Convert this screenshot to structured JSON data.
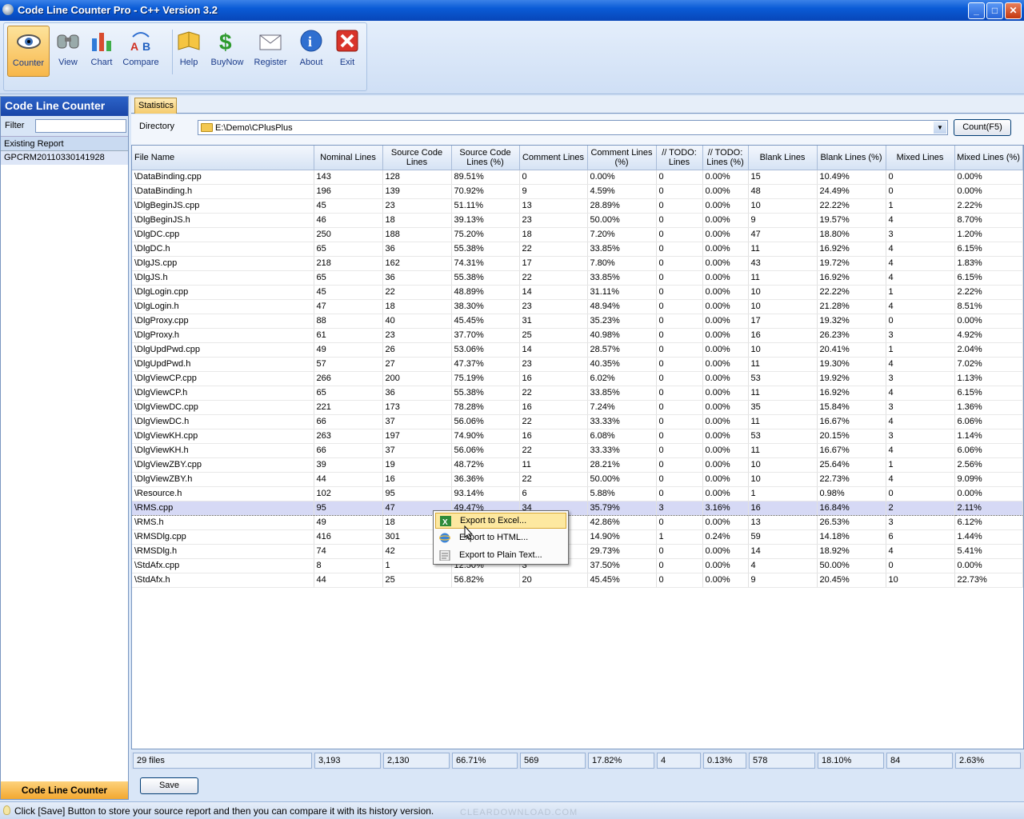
{
  "window": {
    "title": "Code Line Counter Pro - C++ Version 3.2",
    "buttons": {
      "minimize": "_",
      "maximize": "□",
      "close": "✕"
    }
  },
  "toolbar": {
    "items": [
      {
        "label": "Counter",
        "icon": "eye-icon",
        "active": true
      },
      {
        "label": "View",
        "icon": "binoculars-icon"
      },
      {
        "label": "Chart",
        "icon": "chart-icon"
      },
      {
        "label": "Compare",
        "icon": "compare-ab-icon"
      },
      {
        "label": "Help",
        "icon": "book-icon"
      },
      {
        "label": "BuyNow",
        "icon": "dollar-icon"
      },
      {
        "label": "Register",
        "icon": "envelope-icon"
      },
      {
        "label": "About",
        "icon": "info-icon"
      },
      {
        "label": "Exit",
        "icon": "exit-x-icon"
      }
    ]
  },
  "left_panel": {
    "title": "Code Line Counter",
    "filter_label": "Filter",
    "filter_value": "",
    "existing_report_label": "Existing Report",
    "reports": [
      "GPCRM20110330141928"
    ],
    "footer": "Code Line Counter"
  },
  "tab": {
    "label": "Statistics"
  },
  "directory": {
    "label": "Directory",
    "path": "E:\\Demo\\CPlusPlus",
    "count_button": "Count(F5)"
  },
  "table": {
    "columns": [
      "File Name",
      "Nominal Lines",
      "Source Code Lines",
      "Source Code Lines (%)",
      "Comment Lines",
      "Comment Lines (%)",
      "// TODO: Lines",
      "// TODO: Lines (%)",
      "Blank Lines",
      "Blank Lines (%)",
      "Mixed Lines",
      "Mixed Lines (%)"
    ],
    "selected_row": 23,
    "rows": [
      [
        "\\DataBinding.cpp",
        "143",
        "128",
        "89.51%",
        "0",
        "0.00%",
        "0",
        "0.00%",
        "15",
        "10.49%",
        "0",
        "0.00%"
      ],
      [
        "\\DataBinding.h",
        "196",
        "139",
        "70.92%",
        "9",
        "4.59%",
        "0",
        "0.00%",
        "48",
        "24.49%",
        "0",
        "0.00%"
      ],
      [
        "\\DlgBeginJS.cpp",
        "45",
        "23",
        "51.11%",
        "13",
        "28.89%",
        "0",
        "0.00%",
        "10",
        "22.22%",
        "1",
        "2.22%"
      ],
      [
        "\\DlgBeginJS.h",
        "46",
        "18",
        "39.13%",
        "23",
        "50.00%",
        "0",
        "0.00%",
        "9",
        "19.57%",
        "4",
        "8.70%"
      ],
      [
        "\\DlgDC.cpp",
        "250",
        "188",
        "75.20%",
        "18",
        "7.20%",
        "0",
        "0.00%",
        "47",
        "18.80%",
        "3",
        "1.20%"
      ],
      [
        "\\DlgDC.h",
        "65",
        "36",
        "55.38%",
        "22",
        "33.85%",
        "0",
        "0.00%",
        "11",
        "16.92%",
        "4",
        "6.15%"
      ],
      [
        "\\DlgJS.cpp",
        "218",
        "162",
        "74.31%",
        "17",
        "7.80%",
        "0",
        "0.00%",
        "43",
        "19.72%",
        "4",
        "1.83%"
      ],
      [
        "\\DlgJS.h",
        "65",
        "36",
        "55.38%",
        "22",
        "33.85%",
        "0",
        "0.00%",
        "11",
        "16.92%",
        "4",
        "6.15%"
      ],
      [
        "\\DlgLogin.cpp",
        "45",
        "22",
        "48.89%",
        "14",
        "31.11%",
        "0",
        "0.00%",
        "10",
        "22.22%",
        "1",
        "2.22%"
      ],
      [
        "\\DlgLogin.h",
        "47",
        "18",
        "38.30%",
        "23",
        "48.94%",
        "0",
        "0.00%",
        "10",
        "21.28%",
        "4",
        "8.51%"
      ],
      [
        "\\DlgProxy.cpp",
        "88",
        "40",
        "45.45%",
        "31",
        "35.23%",
        "0",
        "0.00%",
        "17",
        "19.32%",
        "0",
        "0.00%"
      ],
      [
        "\\DlgProxy.h",
        "61",
        "23",
        "37.70%",
        "25",
        "40.98%",
        "0",
        "0.00%",
        "16",
        "26.23%",
        "3",
        "4.92%"
      ],
      [
        "\\DlgUpdPwd.cpp",
        "49",
        "26",
        "53.06%",
        "14",
        "28.57%",
        "0",
        "0.00%",
        "10",
        "20.41%",
        "1",
        "2.04%"
      ],
      [
        "\\DlgUpdPwd.h",
        "57",
        "27",
        "47.37%",
        "23",
        "40.35%",
        "0",
        "0.00%",
        "11",
        "19.30%",
        "4",
        "7.02%"
      ],
      [
        "\\DlgViewCP.cpp",
        "266",
        "200",
        "75.19%",
        "16",
        "6.02%",
        "0",
        "0.00%",
        "53",
        "19.92%",
        "3",
        "1.13%"
      ],
      [
        "\\DlgViewCP.h",
        "65",
        "36",
        "55.38%",
        "22",
        "33.85%",
        "0",
        "0.00%",
        "11",
        "16.92%",
        "4",
        "6.15%"
      ],
      [
        "\\DlgViewDC.cpp",
        "221",
        "173",
        "78.28%",
        "16",
        "7.24%",
        "0",
        "0.00%",
        "35",
        "15.84%",
        "3",
        "1.36%"
      ],
      [
        "\\DlgViewDC.h",
        "66",
        "37",
        "56.06%",
        "22",
        "33.33%",
        "0",
        "0.00%",
        "11",
        "16.67%",
        "4",
        "6.06%"
      ],
      [
        "\\DlgViewKH.cpp",
        "263",
        "197",
        "74.90%",
        "16",
        "6.08%",
        "0",
        "0.00%",
        "53",
        "20.15%",
        "3",
        "1.14%"
      ],
      [
        "\\DlgViewKH.h",
        "66",
        "37",
        "56.06%",
        "22",
        "33.33%",
        "0",
        "0.00%",
        "11",
        "16.67%",
        "4",
        "6.06%"
      ],
      [
        "\\DlgViewZBY.cpp",
        "39",
        "19",
        "48.72%",
        "11",
        "28.21%",
        "0",
        "0.00%",
        "10",
        "25.64%",
        "1",
        "2.56%"
      ],
      [
        "\\DlgViewZBY.h",
        "44",
        "16",
        "36.36%",
        "22",
        "50.00%",
        "0",
        "0.00%",
        "10",
        "22.73%",
        "4",
        "9.09%"
      ],
      [
        "\\Resource.h",
        "102",
        "95",
        "93.14%",
        "6",
        "5.88%",
        "0",
        "0.00%",
        "1",
        "0.98%",
        "0",
        "0.00%"
      ],
      [
        "\\RMS.cpp",
        "95",
        "47",
        "49.47%",
        "34",
        "35.79%",
        "3",
        "3.16%",
        "16",
        "16.84%",
        "2",
        "2.11%"
      ],
      [
        "\\RMS.h",
        "49",
        "18",
        "",
        "",
        "42.86%",
        "0",
        "0.00%",
        "13",
        "26.53%",
        "3",
        "6.12%"
      ],
      [
        "\\RMSDlg.cpp",
        "416",
        "301",
        "",
        "",
        "14.90%",
        "1",
        "0.24%",
        "59",
        "14.18%",
        "6",
        "1.44%"
      ],
      [
        "\\RMSDlg.h",
        "74",
        "42",
        "",
        "",
        "29.73%",
        "0",
        "0.00%",
        "14",
        "18.92%",
        "4",
        "5.41%"
      ],
      [
        "\\StdAfx.cpp",
        "8",
        "1",
        "12.50%",
        "3",
        "37.50%",
        "0",
        "0.00%",
        "4",
        "50.00%",
        "0",
        "0.00%"
      ],
      [
        "\\StdAfx.h",
        "44",
        "25",
        "56.82%",
        "20",
        "45.45%",
        "0",
        "0.00%",
        "9",
        "20.45%",
        "10",
        "22.73%"
      ]
    ],
    "totals": [
      "29 files",
      "3,193",
      "2,130",
      "66.71%",
      "569",
      "17.82%",
      "4",
      "0.13%",
      "578",
      "18.10%",
      "84",
      "2.63%"
    ]
  },
  "context_menu": {
    "items": [
      {
        "label": "Export to Excel...",
        "icon": "excel-icon",
        "highlighted": true
      },
      {
        "label": "Export to HTML...",
        "icon": "ie-globe-icon"
      },
      {
        "label": "Export to Plain Text...",
        "icon": "text-file-icon"
      }
    ]
  },
  "save_button": "Save",
  "status": {
    "message": "Click [Save] Button to store your source report and then you can compare it with its history version.",
    "watermark": "CLEARDOWNLOAD.COM"
  }
}
